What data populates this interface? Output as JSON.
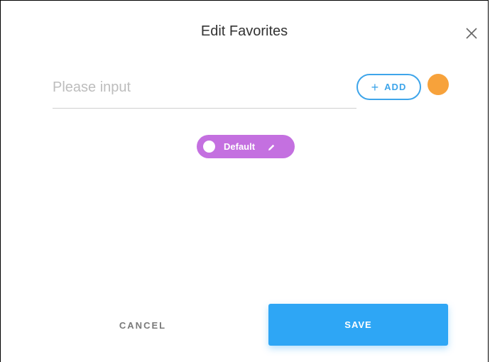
{
  "dialog": {
    "title": "Edit Favorites",
    "close_icon": "close-icon"
  },
  "favorite_input": {
    "value": "",
    "placeholder": "Please input"
  },
  "add_button": {
    "label": "ADD",
    "icon": "plus-icon",
    "color": "#3ea5ea"
  },
  "color_picker": {
    "selected_color": "#f7a23b"
  },
  "tags": [
    {
      "label": "Default",
      "color": "#c470e0",
      "edit_icon": "pencil-icon"
    }
  ],
  "footer": {
    "cancel_label": "CANCEL",
    "save_label": "SAVE",
    "save_color": "#2ea6f5"
  }
}
